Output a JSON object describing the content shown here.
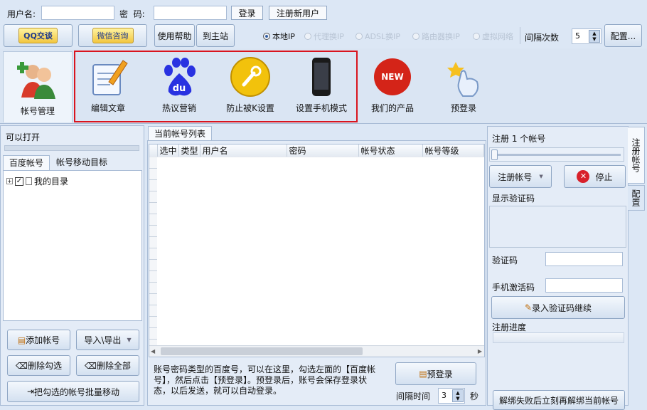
{
  "login": {
    "username_label": "用户名:",
    "username_value": "",
    "password_label": "密  码:",
    "password_value": "",
    "login_button": "登录",
    "register_button": "注册新用户"
  },
  "toolbar": {
    "qq_button": "QQ交谈",
    "wechat_button": "微信咨询",
    "help_button": "使用帮助",
    "site_button": "到主站",
    "ip_modes": [
      {
        "label": "本地IP",
        "selected": true
      },
      {
        "label": "代理换IP",
        "selected": false
      },
      {
        "label": "ADSL换IP",
        "selected": false
      },
      {
        "label": "路由器换IP",
        "selected": false
      },
      {
        "label": "虚拟网络",
        "selected": false
      }
    ],
    "interval_label": "间隔次数",
    "interval_value": "5",
    "config_button": "配置..."
  },
  "modules": {
    "items": [
      "帐号管理",
      "编辑文章",
      "热议营销",
      "防止被K设置",
      "设置手机模式",
      "我们的产品",
      "预登录"
    ],
    "highlight_color": "#d9141e",
    "baidu_logo": "du",
    "new_badge": "NEW"
  },
  "left": {
    "can_open_label": "可以打开",
    "tabs": [
      "百度帐号",
      "帐号移动目标"
    ],
    "tree_root": "我的目录",
    "buttons": {
      "add": "添加帐号",
      "import_export": "导入\\导出",
      "delete_checked": "删除勾选",
      "delete_all": "删除全部",
      "batch_move": "把勾选的帐号批量移动"
    }
  },
  "center": {
    "tab": "当前帐号列表",
    "columns": [
      "选中",
      "类型",
      "用户名",
      "密码",
      "帐号状态",
      "帐号等级"
    ],
    "rows": [],
    "description": "账号密码类型的百度号，可以在这里，勾选左面的【百度帐号】，然后点击【预登录】。预登录后，账号会保存登录状态，以后发送，就可以自动登录。",
    "prelogin_button": "预登录",
    "interval_label": "间隔时间",
    "interval_value": "3",
    "seconds_label": "秒"
  },
  "right": {
    "register_count_label": "注册 1 个帐号",
    "slider_value": 1,
    "register_button": "注册帐号",
    "stop_button": "停止",
    "captcha_display_label": "显示验证码",
    "captcha_label": "验证码",
    "captcha_value": "",
    "sms_label": "手机激活码",
    "sms_value": "",
    "continue_button": "录入验证码继续",
    "progress_label": "注册进度",
    "progress": 0,
    "unbind_button": "解绑失败后立刻再解绑当前帐号",
    "side_tabs": [
      "注册帐号",
      "配置"
    ]
  }
}
